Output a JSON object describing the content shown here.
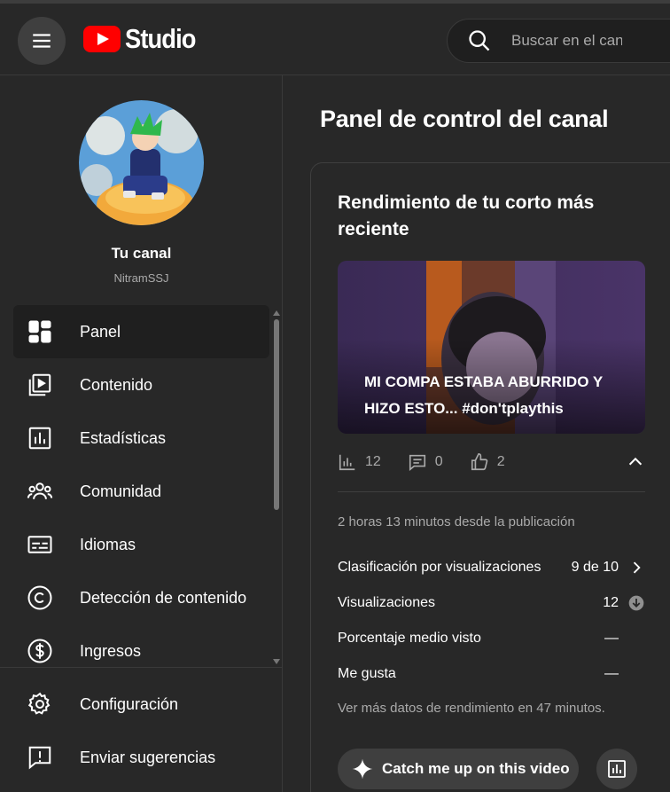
{
  "header": {
    "logo_text": "Studio",
    "search_placeholder": "Buscar en el canal"
  },
  "sidebar": {
    "channel_title": "Tu canal",
    "channel_handle": "NitramSSJ",
    "items": [
      {
        "label": "Panel",
        "icon": "dashboard-icon",
        "active": true
      },
      {
        "label": "Contenido",
        "icon": "content-icon"
      },
      {
        "label": "Estadísticas",
        "icon": "analytics-icon"
      },
      {
        "label": "Comunidad",
        "icon": "community-icon"
      },
      {
        "label": "Idiomas",
        "icon": "subtitles-icon"
      },
      {
        "label": "Detección de contenido",
        "icon": "copyright-icon"
      },
      {
        "label": "Ingresos",
        "icon": "dollar-icon"
      }
    ],
    "bottom_items": [
      {
        "label": "Configuración",
        "icon": "gear-icon"
      },
      {
        "label": "Enviar sugerencias",
        "icon": "feedback-icon"
      }
    ]
  },
  "main": {
    "page_title": "Panel de control del canal",
    "card": {
      "title": "Rendimiento de tu corto más reciente",
      "video_title": "MI COMPA ESTABA ABURRIDO Y HIZO ESTO... #don'tplaythis",
      "stats": {
        "views": "12",
        "comments": "0",
        "likes": "2"
      },
      "published": "2 horas 13 minutos desde la publicación",
      "metrics": [
        {
          "label": "Clasificación por visualizaciones",
          "value": "9 de 10",
          "icon": "chevron-right-icon"
        },
        {
          "label": "Visualizaciones",
          "value": "12",
          "icon": "arrow-down-circle-icon"
        },
        {
          "label": "Porcentaje medio visto",
          "value": "—"
        },
        {
          "label": "Me gusta",
          "value": "—"
        }
      ],
      "more_data": "Ver más datos de rendimiento en 47 minutos.",
      "catchup_label": "Catch me up on this video"
    }
  }
}
